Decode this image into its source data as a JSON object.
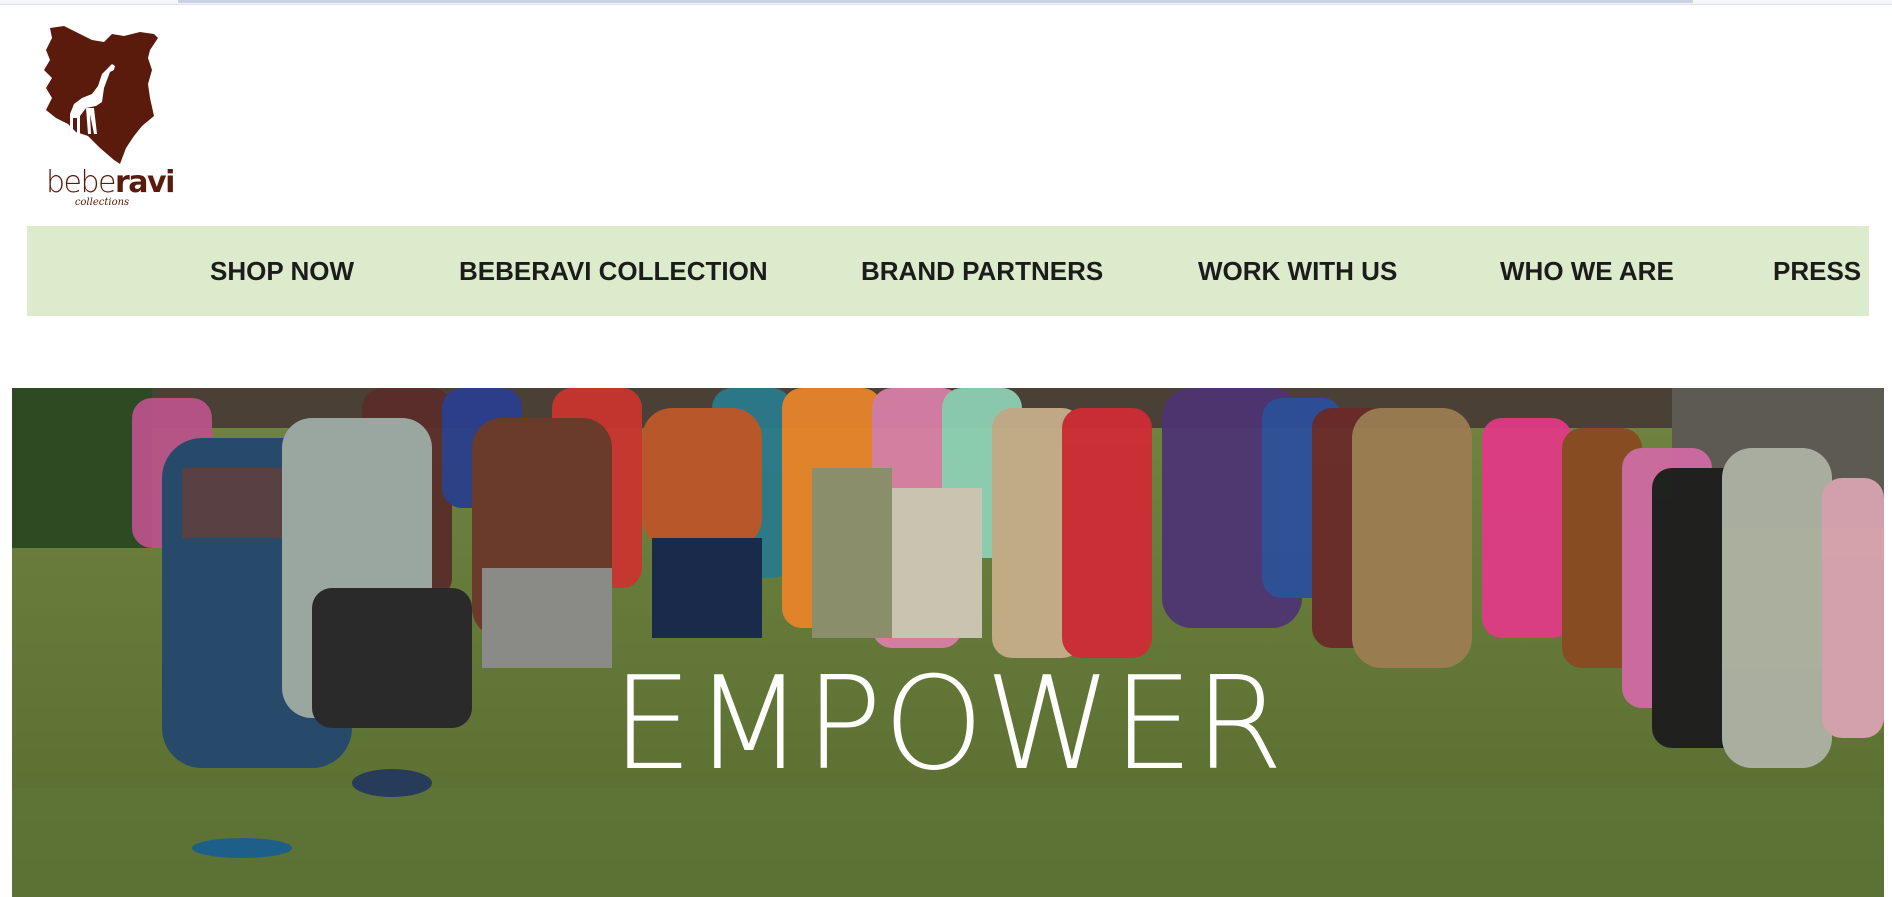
{
  "brand": {
    "name_light": "bebe",
    "name_bold": "ravi",
    "subtitle": "collections",
    "color": "#5a1a0c"
  },
  "nav": {
    "background": "#dcebcc",
    "items": [
      {
        "label": "SHOP NOW"
      },
      {
        "label": "BEBERAVI COLLECTION"
      },
      {
        "label": "BRAND PARTNERS"
      },
      {
        "label": "WORK WITH US"
      },
      {
        "label": "WHO WE ARE"
      },
      {
        "label": "PRESS"
      }
    ]
  },
  "hero": {
    "title": "EMPOWER",
    "image_description_icon": "group-of-dancing-women-photo"
  }
}
